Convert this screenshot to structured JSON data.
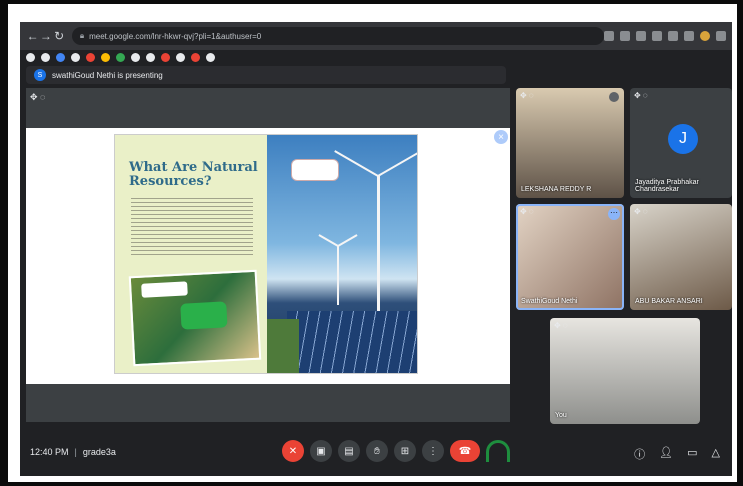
{
  "browser": {
    "url": "meet.google.com/lnr-hkwr-qvj?pli=1&authuser=0"
  },
  "presenting": {
    "avatar_letter": "S",
    "text": "swathiGoud Nethi is presenting"
  },
  "slide": {
    "title_line1": "What Are Natural",
    "title_line2": "Resources?"
  },
  "participants": [
    {
      "name": "LEKSHANA REDDY R"
    },
    {
      "name": "Jayaditya Prabhakar Chandrasekar",
      "avatar": "J"
    },
    {
      "name": "SwathiGoud Nethi"
    },
    {
      "name": "ABU BAKAR ANSARI"
    },
    {
      "name": "You"
    }
  ],
  "bottom": {
    "time": "12:40 PM",
    "separator": "|",
    "meeting": "grade3a"
  },
  "colors": {
    "end_call": "#ea4335",
    "accent": "#1a73e8",
    "toolbar": "#202124"
  }
}
